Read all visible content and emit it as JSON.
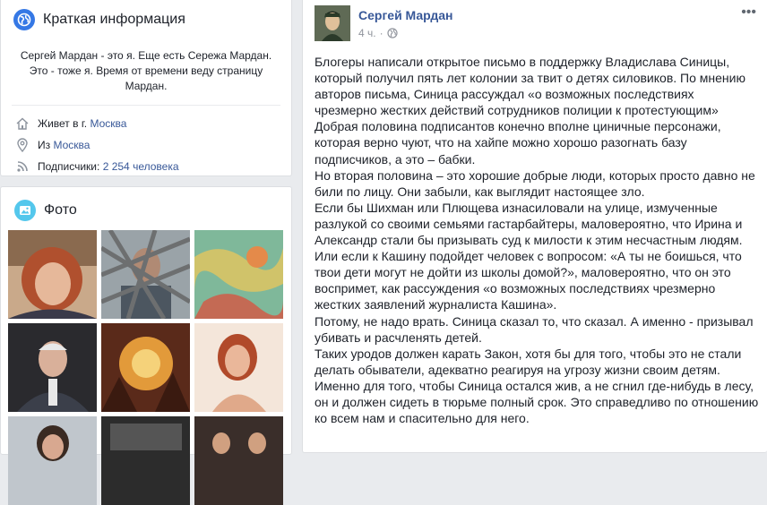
{
  "intro": {
    "title": "Краткая информация",
    "bio": "Сергей Мардан - это я. Еще есть Сережа Мардан. Это - тоже я. Время от времени веду страницу Мардан.",
    "lives_prefix": "Живет в г.",
    "lives_city": "Москва",
    "from_prefix": "Из",
    "from_city": "Москва",
    "followers_prefix": "Подписчики:",
    "followers_value": "2 254 человека"
  },
  "photos": {
    "title": "Фото"
  },
  "post": {
    "author": "Сергей Мардан",
    "time": "4 ч.",
    "more_label": "•••",
    "paragraphs": [
      "Блогеры написали открытое письмо в поддержку Владислава Синицы, который получил пять лет колонии за твит о детях силовиков. По мнению авторов письма, Синица рассуждал «о возможных последствиях чрезмерно жестких действий сотрудников полиции к протестующим»",
      "Добрая половина подписантов конечно вполне циничные персонажи, которая верно чуют, что на хайпе можно хорошо разогнать базу подписчиков, а это – бабки.",
      "Но вторая половина – это хорошие добрые люди, которых просто давно не били по лицу. Они забыли, как выглядит настоящее зло.",
      "Если бы Шихман или Плющева изнасиловали на улице, измученные разлукой со своими семьями гастарбайтеры, маловероятно, что Ирина и Александр стали бы призывать суд к милости к этим несчастным людям.",
      "Или если к Кашину подойдет человек с вопросом: «А ты не боишься, что твои дети могут не дойти из школы домой?», маловероятно, что он это воспримет, как рассуждения «о возможных последствиях чрезмерно жестких заявлений журналиста Кашина».",
      "Потому, не надо врать. Синица сказал то, что сказал. А именно - призывал убивать и расчленять детей.",
      "Таких уродов должен карать Закон, хотя бы для того, чтобы это не стали делать обыватели, адекватно реагируя на угрозу жизни своим детям.",
      "Именно для того, чтобы Синица остался жив, а не сгнил где-нибудь в лесу, он и должен сидеть в тюрьме полный срок. Это справедливо по отношению ко всем нам и спасительно для него."
    ]
  },
  "colors": {
    "link": "#385898",
    "intro_icon_bg": "#3578e5",
    "photo_icon_bg": "#54c7ec",
    "muted": "#90949c"
  }
}
